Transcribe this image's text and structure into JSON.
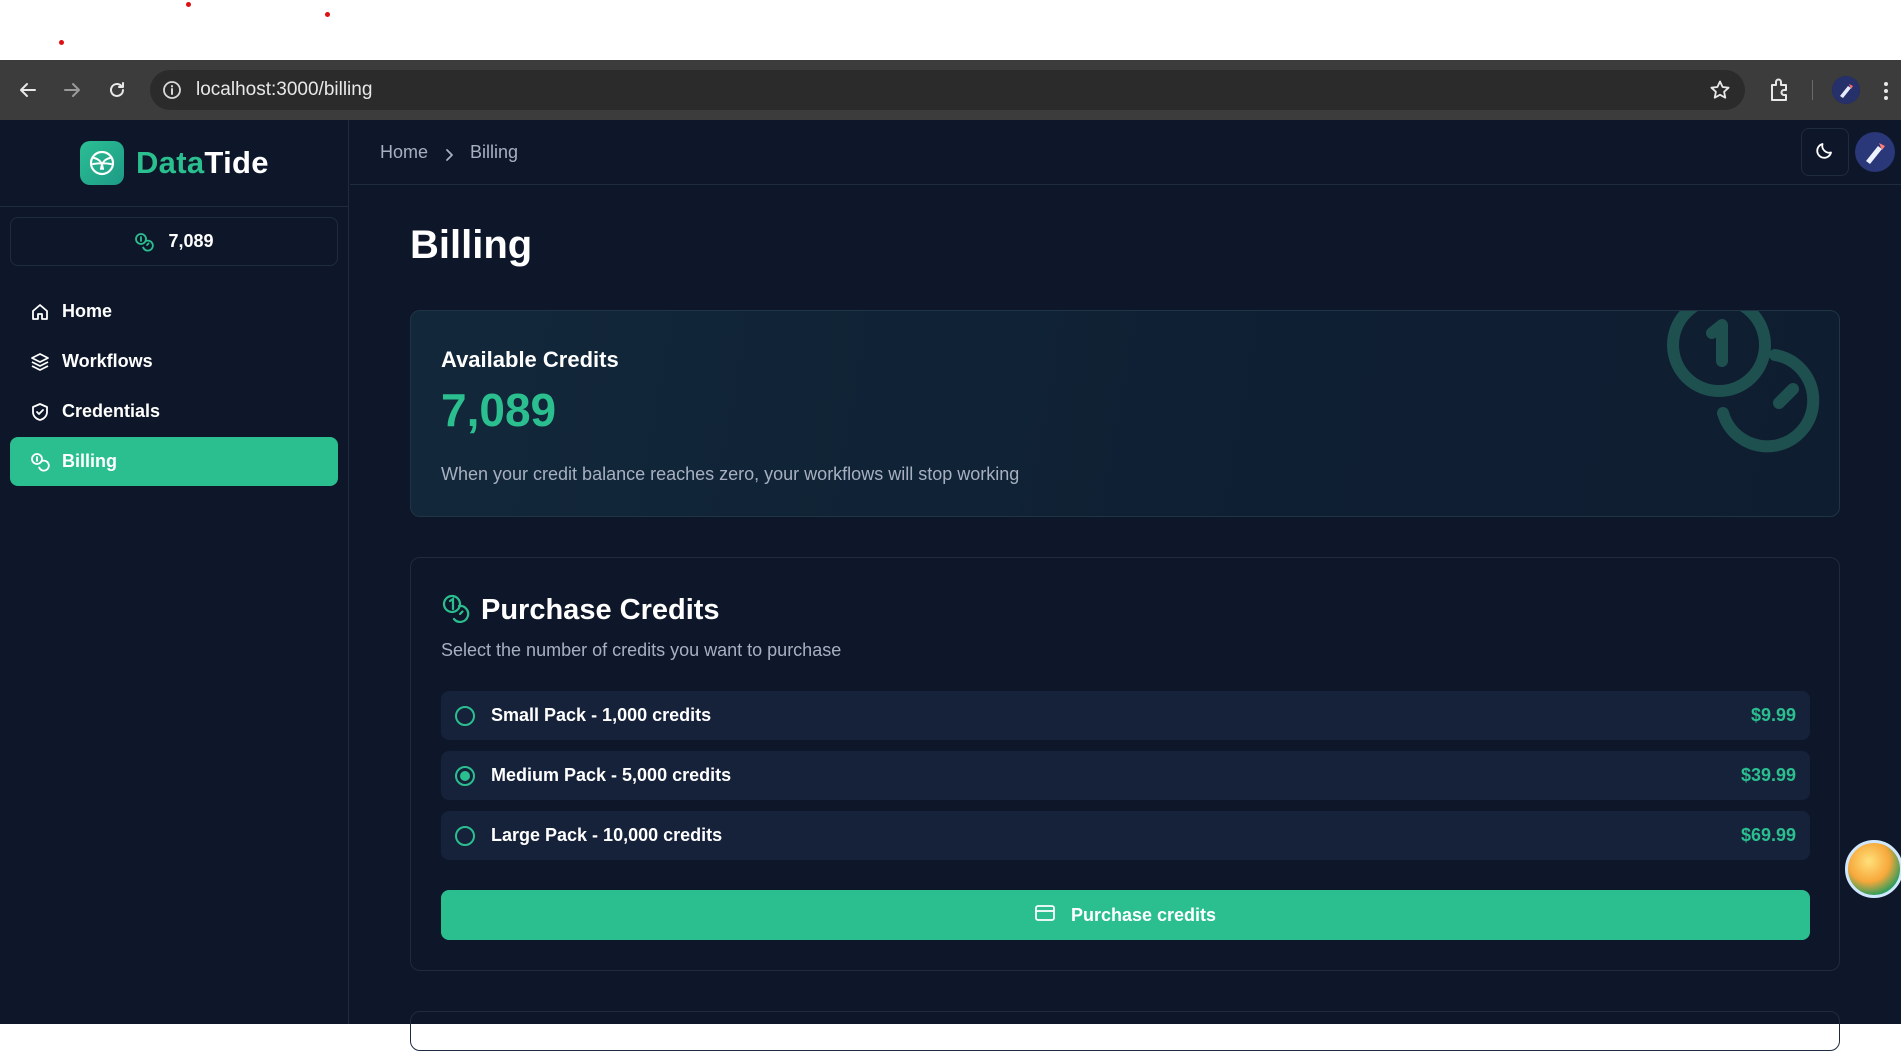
{
  "browser": {
    "url": "localhost:3000/billing"
  },
  "app": {
    "logo": {
      "part1": "Data",
      "part2": "Tide"
    },
    "sidebar": {
      "credits": "7,089",
      "items": [
        {
          "label": "Home",
          "icon": "home-icon",
          "active": false
        },
        {
          "label": "Workflows",
          "icon": "layers-icon",
          "active": false
        },
        {
          "label": "Credentials",
          "icon": "shield-icon",
          "active": false
        },
        {
          "label": "Billing",
          "icon": "coins-icon",
          "active": true
        }
      ]
    },
    "breadcrumb": {
      "home": "Home",
      "current": "Billing"
    }
  },
  "page": {
    "title": "Billing",
    "available": {
      "title": "Available Credits",
      "value": "7,089",
      "description": "When your credit balance reaches zero, your workflows will stop working"
    },
    "purchase": {
      "title": "Purchase Credits",
      "subtitle": "Select the number of credits you want to purchase",
      "packs": [
        {
          "label": "Small Pack - 1,000 credits",
          "price": "$9.99",
          "selected": false
        },
        {
          "label": "Medium Pack - 5,000 credits",
          "price": "$39.99",
          "selected": true
        },
        {
          "label": "Large Pack - 10,000 credits",
          "price": "$69.99",
          "selected": false
        }
      ],
      "button_label": "Purchase credits"
    }
  },
  "colors": {
    "accent": "#2bbf8f",
    "background": "#0e1729",
    "browser_bar": "#3c3c3c"
  }
}
